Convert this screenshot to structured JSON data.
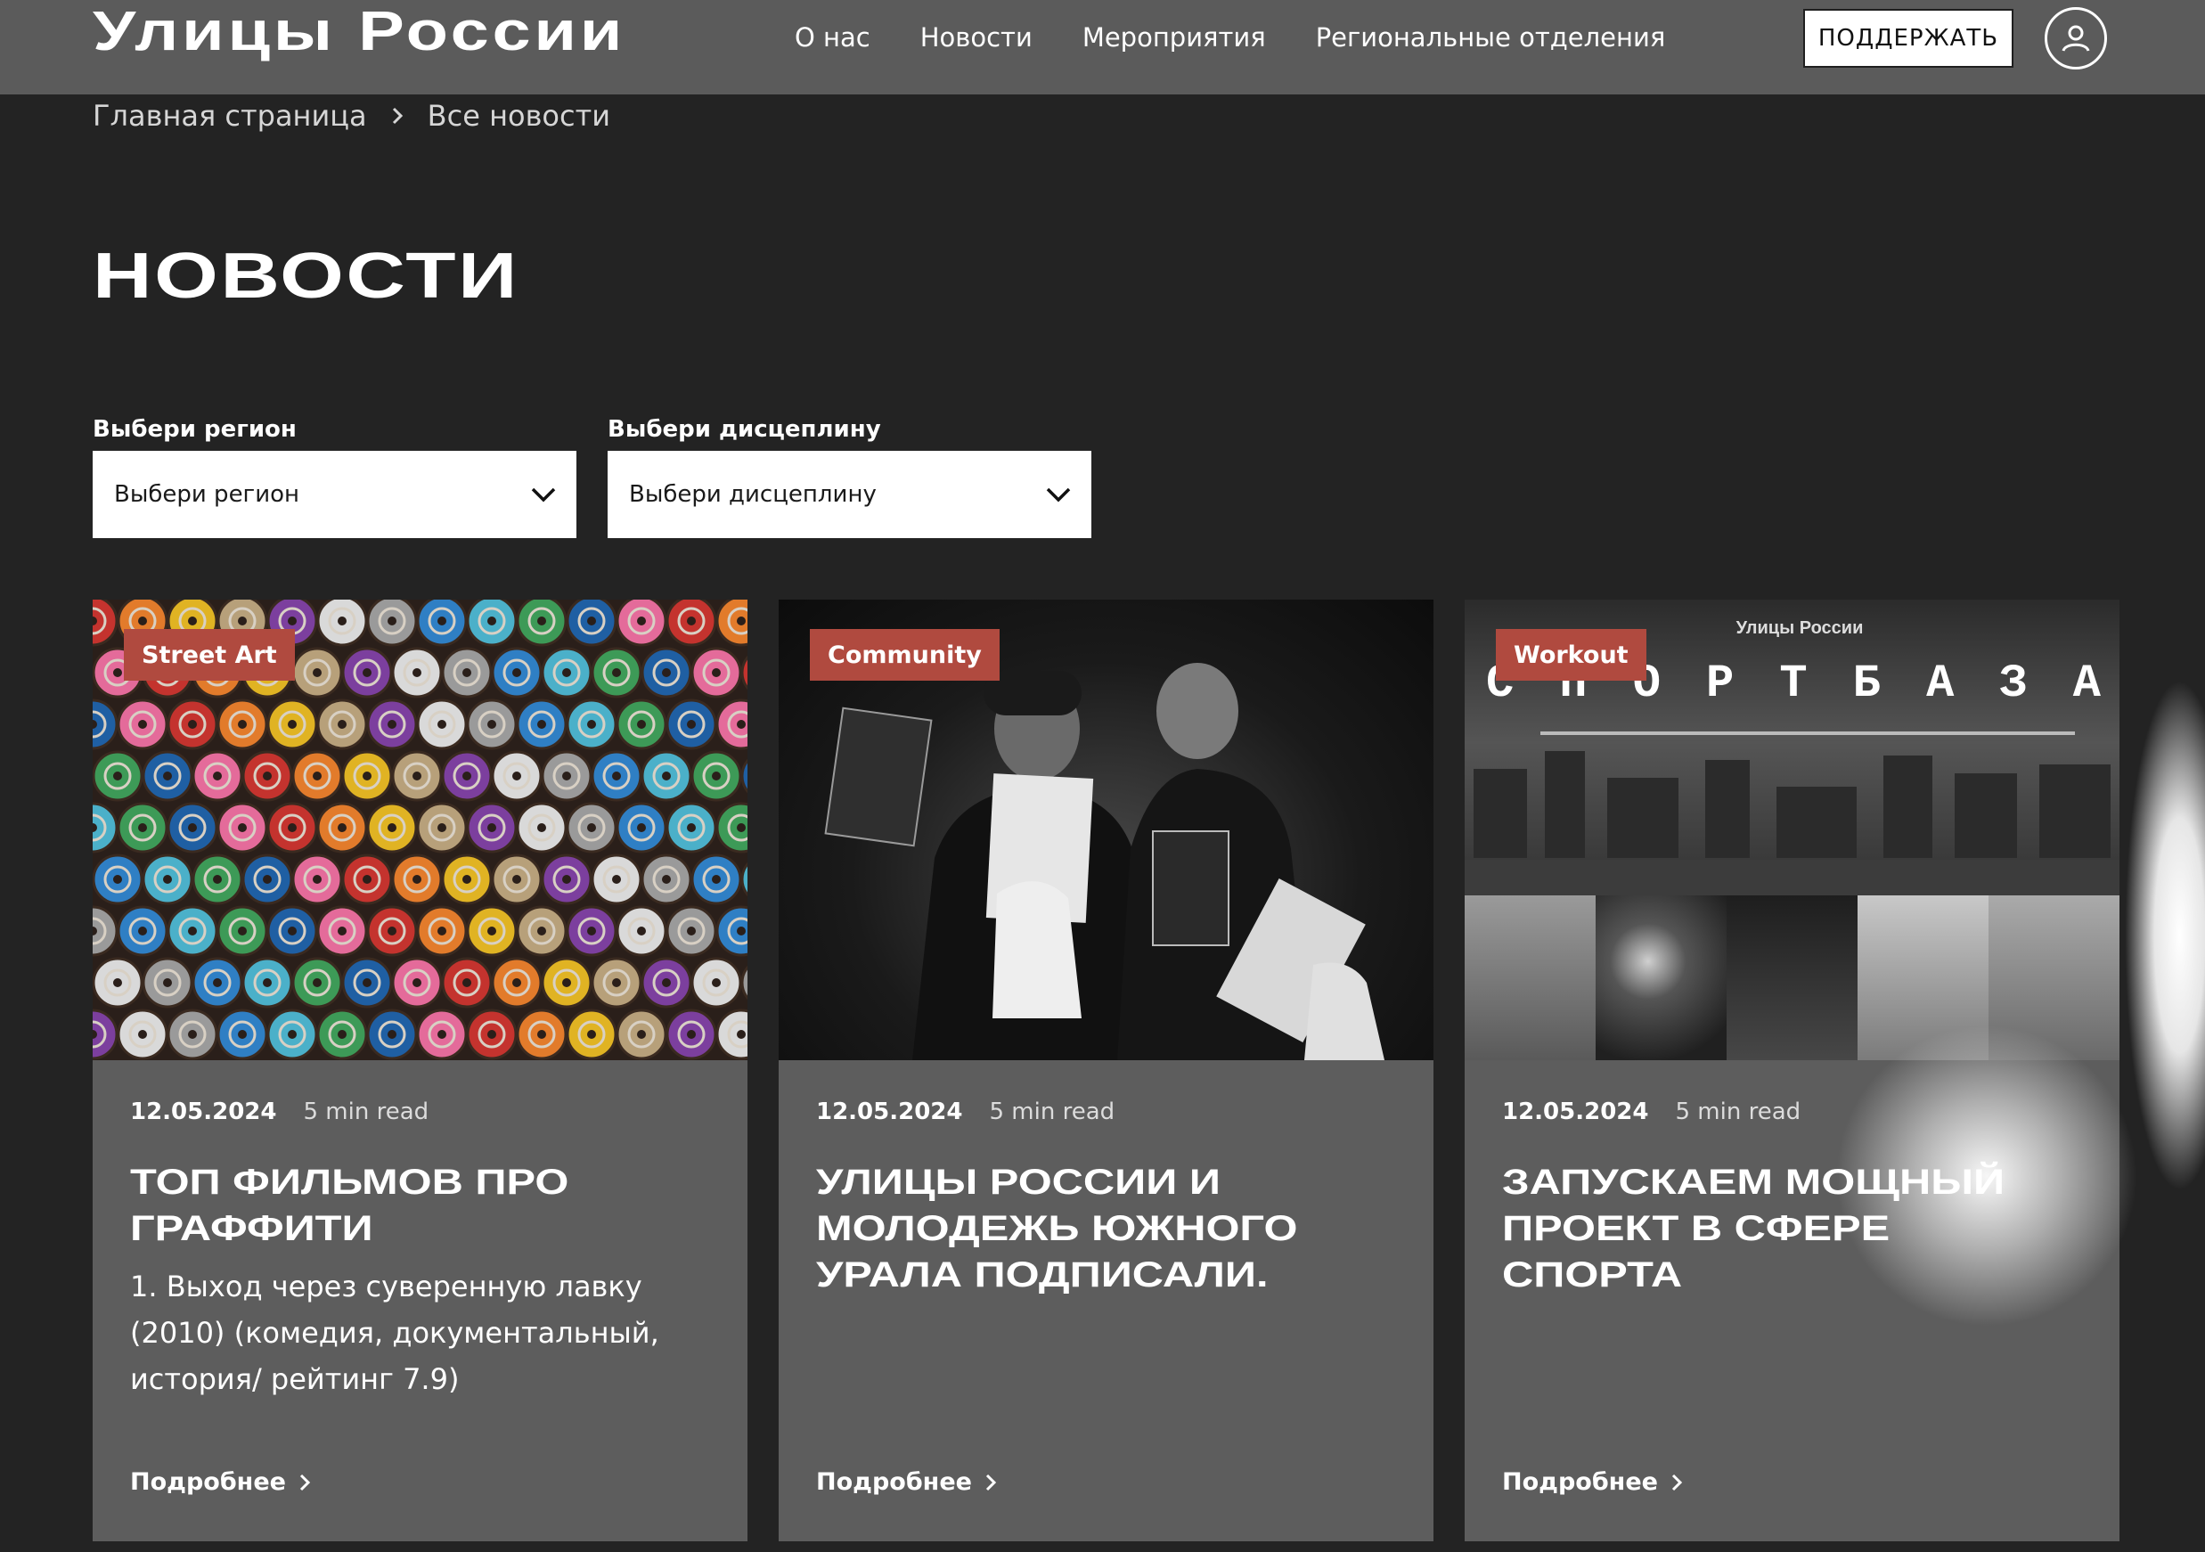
{
  "header": {
    "logo": "Улицы России",
    "nav": [
      "О нас",
      "Новости",
      "Мероприятия",
      "Региональные отделения"
    ],
    "support_label": "ПОДДЕРЖАТЬ",
    "profile_icon": "user-icon"
  },
  "breadcrumb": {
    "home": "Главная страница",
    "current": "Все новости"
  },
  "page_title": "НОВОСТИ",
  "filters": {
    "region": {
      "label": "Выбери регион",
      "value": "Выбери регион"
    },
    "discipline": {
      "label": "Выбери дисцеплину",
      "value": "Выбери дисцеплину"
    }
  },
  "cards": [
    {
      "tag": "Street Art",
      "date": "12.05.2024",
      "read_time": "5 min read",
      "title": "ТОП ФИЛЬМОВ ПРО ГРАФФИТИ",
      "excerpt": "1. Выход через суверенную лавку (2010) (комедия, документальный, история/ рейтинг 7.9)",
      "more": "Подробнее",
      "image": "spray-cans-photo"
    },
    {
      "tag": "Community",
      "date": "12.05.2024",
      "read_time": "5 min read",
      "title": "УЛИЦЫ РОССИИ И МОЛОДЕЖЬ ЮЖНОГО УРАЛА ПОДПИСАЛИ.",
      "excerpt": "",
      "more": "Подробнее",
      "image": "two-men-with-certificates-photo"
    },
    {
      "tag": "Workout",
      "date": "12.05.2024",
      "read_time": "5 min read",
      "title": "ЗАПУСКАЕМ МОЩНЫЙ ПРОЕКТ В СФЕРЕ СПОРТА",
      "excerpt": "",
      "more": "Подробнее",
      "image": "sportbaza-collage",
      "image_text": "СПОРТБАЗА",
      "image_logo": "Улицы России"
    }
  ],
  "colors": {
    "header": "#5b5b5b",
    "page": "#232323",
    "card": "#5d5d5d",
    "tag": "#b04a3f"
  }
}
